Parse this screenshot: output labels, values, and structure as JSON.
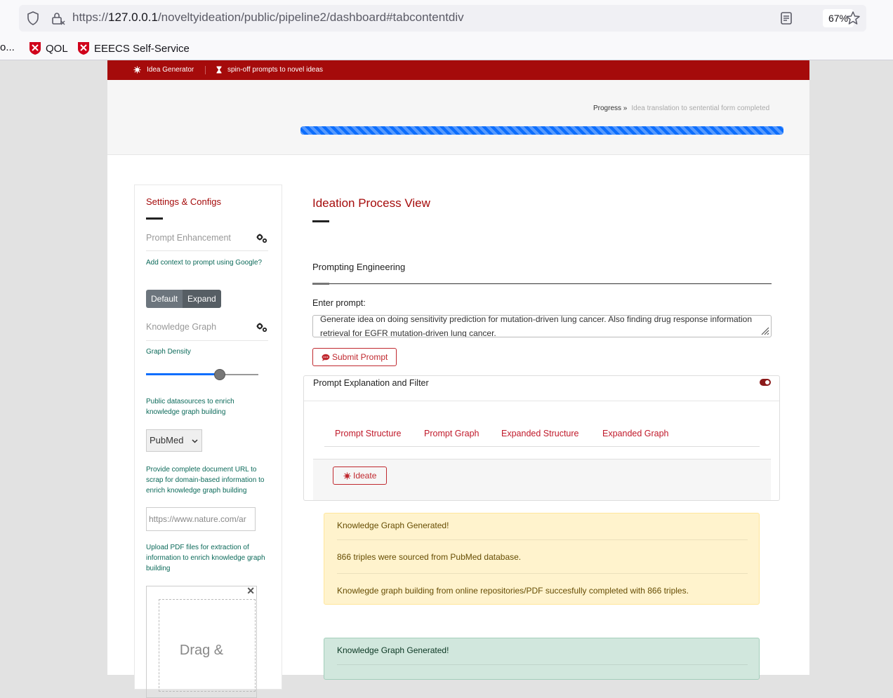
{
  "browser": {
    "url_prefix": "https://",
    "url_host": "127.0.0.1",
    "url_path": "/noveltyideation/public/pipeline2/dashboard#tabcontentdiv",
    "zoom": "67%",
    "bookmarks": [
      {
        "label": "o..."
      },
      {
        "label": "QOL"
      },
      {
        "label": "EEECS Self-Service"
      }
    ]
  },
  "topnav": {
    "item1": "Idea Generator",
    "item2": "spin-off prompts to novel ideas"
  },
  "progress": {
    "label": "Progress »",
    "status": "Idea translation to sentential form completed",
    "value": 1.0
  },
  "sidebar": {
    "title": "Settings & Configs",
    "prompt_enhancement": "Prompt Enhancement",
    "add_context_help": "Add context to prompt using Google?",
    "btn_default": "Default",
    "btn_expand": "Expand",
    "knowledge_graph": "Knowledge Graph",
    "graph_density": "Graph Density",
    "density_value": 0.65,
    "public_sources_help": "Public datasources to enrich knowledge graph building",
    "datasource_selected": "PubMed",
    "url_help": "Provide complete document URL to scrap for domain-based information to enrich knowledge graph building",
    "url_placeholder": "https://www.nature.com/ar",
    "pdf_help": "Upload PDF files for extraction of information to enrich knowledge graph building",
    "dropzone_label": "Drag &"
  },
  "main": {
    "title": "Ideation Process View",
    "section": "Prompting Engineering",
    "enter_prompt": "Enter prompt:",
    "prompt_text": "Generate idea on doing sensitivity prediction for mutation-driven lung cancer. Also finding drug response information retrieval for EGFR mutation-driven lung cancer.",
    "submit_btn": "Submit Prompt",
    "card_title": "Prompt Explanation and Filter",
    "tabs": [
      "Prompt Structure",
      "Prompt Graph",
      "Expanded Structure",
      "Expanded Graph"
    ],
    "ideate_btn": "Ideate"
  },
  "alerts": {
    "warn_title": "Knowledge Graph Generated!",
    "warn_line1": "866 triples were sourced from PubMed database.",
    "warn_line2": "Knowlegde graph building from online repositories/PDF succesfully completed with 866 triples.",
    "ok_title": "Knowledge Graph Generated!"
  },
  "colors": {
    "brand": "#a50b0b",
    "accent_blue": "#0d6efd",
    "help_green": "#0c6a5a"
  }
}
